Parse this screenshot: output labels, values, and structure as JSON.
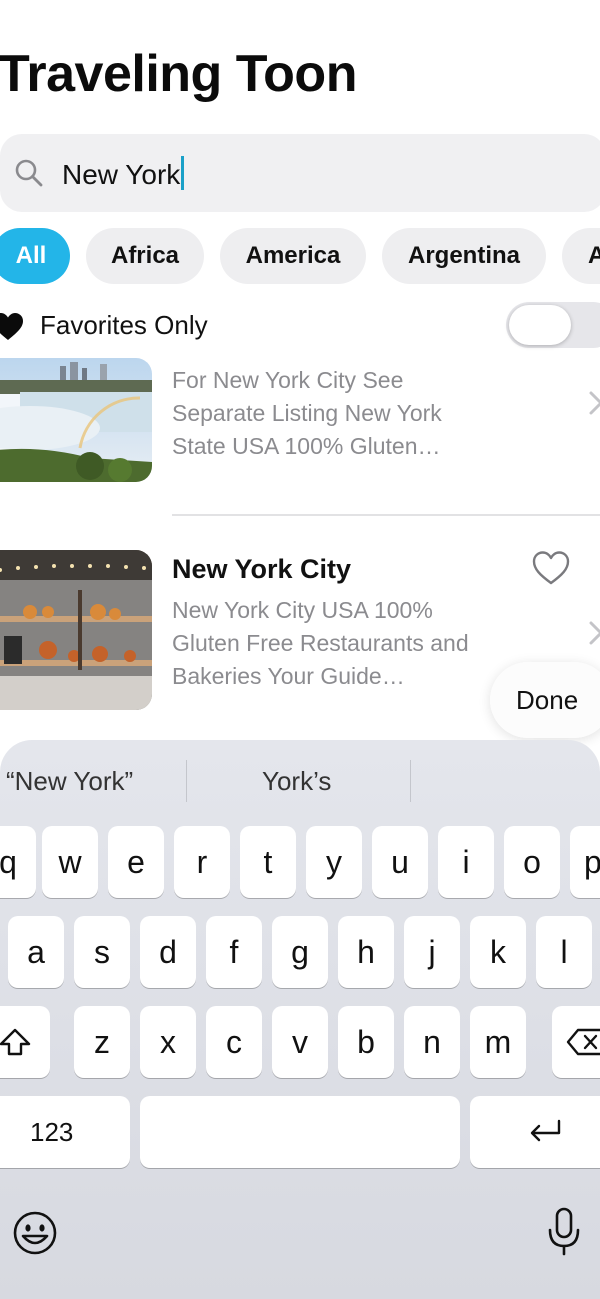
{
  "app": {
    "title": "Traveling Toon"
  },
  "search": {
    "value": "New York",
    "icon": "search-icon"
  },
  "categories": [
    "All",
    "Africa",
    "America",
    "Argentina",
    "A"
  ],
  "favorites": {
    "label": "Favorites Only",
    "enabled": false
  },
  "results": [
    {
      "name": "",
      "description": "For New York City See Separate Listing New York State USA 100% Gluten…"
    },
    {
      "name": "New York City",
      "description": "New York City USA 100% Gluten Free Restaurants and Bakeries Your Guide…"
    }
  ],
  "done_label": "Done",
  "keyboard": {
    "suggestions": [
      "“New York”",
      "York’s"
    ],
    "row1": [
      "q",
      "w",
      "e",
      "r",
      "t",
      "y",
      "u",
      "i",
      "o",
      "p"
    ],
    "row2": [
      "a",
      "s",
      "d",
      "f",
      "g",
      "h",
      "j",
      "k",
      "l"
    ],
    "row3": [
      "z",
      "x",
      "c",
      "v",
      "b",
      "n",
      "m"
    ],
    "numbers_label": "123"
  }
}
